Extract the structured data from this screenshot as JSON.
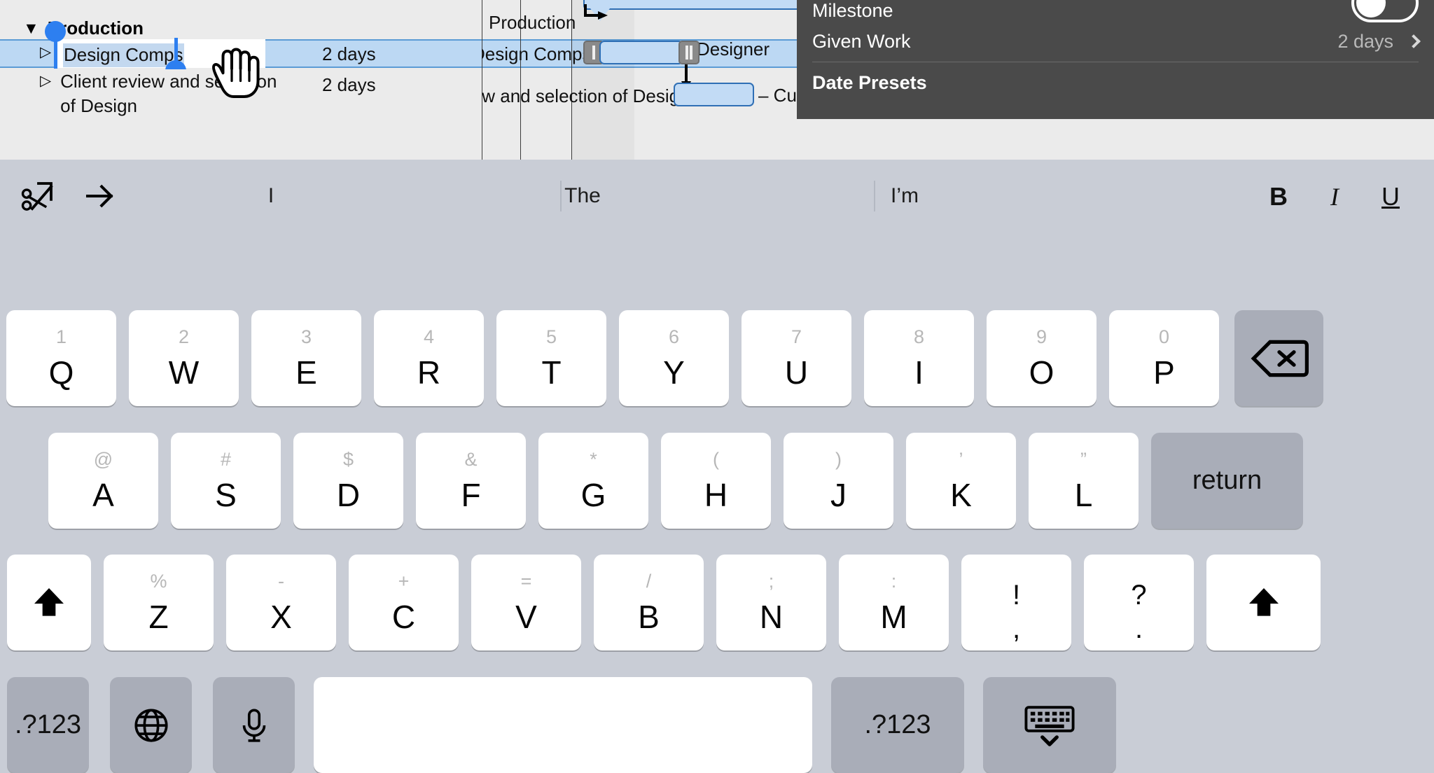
{
  "outline": {
    "group": {
      "triangle": "▼",
      "label": "Production"
    },
    "tasks": [
      {
        "triangle": "▷",
        "name": "Design Comps",
        "duration": "2 days",
        "editing": true
      },
      {
        "triangle": "▷",
        "name": "Client review and selection of Design",
        "duration": "2 days",
        "editing": false
      }
    ]
  },
  "gantt": {
    "labels": {
      "production": "Production",
      "design_comps": "Design Comps",
      "client_review": "iew and selection of Design",
      "designer": "Designer",
      "customer": "– Custo"
    }
  },
  "popover": {
    "milestone_label": "Milestone",
    "milestone_toggle": "off",
    "given_work": {
      "label": "Given Work",
      "value": "2 days",
      "chevron": "chevron-right"
    },
    "date_presets_label": "Date Presets"
  },
  "keyboard": {
    "toolbar": {
      "cut_icon": "scissors-icon",
      "indent_icon": "arrow-right-icon",
      "bold": "B",
      "italic": "I",
      "underline": "U"
    },
    "predictions": [
      "I",
      "The",
      "I’m"
    ],
    "rows": [
      [
        {
          "main": "Q",
          "alt": "1"
        },
        {
          "main": "W",
          "alt": "2"
        },
        {
          "main": "E",
          "alt": "3"
        },
        {
          "main": "R",
          "alt": "4"
        },
        {
          "main": "T",
          "alt": "5"
        },
        {
          "main": "Y",
          "alt": "6"
        },
        {
          "main": "U",
          "alt": "7"
        },
        {
          "main": "I",
          "alt": "8"
        },
        {
          "main": "O",
          "alt": "9"
        },
        {
          "main": "P",
          "alt": "0"
        }
      ],
      [
        {
          "main": "A",
          "alt": "@"
        },
        {
          "main": "S",
          "alt": "#"
        },
        {
          "main": "D",
          "alt": "$"
        },
        {
          "main": "F",
          "alt": "&"
        },
        {
          "main": "G",
          "alt": "*"
        },
        {
          "main": "H",
          "alt": "("
        },
        {
          "main": "J",
          "alt": ")"
        },
        {
          "main": "K",
          "alt": "’"
        },
        {
          "main": "L",
          "alt": "”"
        }
      ],
      [
        {
          "main": "Z",
          "alt": "%"
        },
        {
          "main": "X",
          "alt": "-"
        },
        {
          "main": "C",
          "alt": "+"
        },
        {
          "main": "V",
          "alt": "="
        },
        {
          "main": "B",
          "alt": "/"
        },
        {
          "main": "N",
          "alt": ";"
        },
        {
          "main": "M",
          "alt": ":"
        }
      ]
    ],
    "punctuation": [
      {
        "main": "!",
        "sub": ","
      },
      {
        "main": "?",
        "sub": "."
      }
    ],
    "special": {
      "backspace": "backspace-icon",
      "return": "return",
      "shift_left": "shift-icon",
      "shift_right": "shift-icon",
      "numbers_left": ".?123",
      "globe": "globe-icon",
      "microphone": "microphone-icon",
      "space": "",
      "numbers_right": ".?123",
      "hide_keyboard": "hide-keyboard-icon"
    }
  },
  "colors": {
    "selection_blue": "#bcd8f3",
    "accent_blue": "#2d7ff0",
    "bar_fill": "#c2dbf5",
    "bar_stroke": "#2f6fb5",
    "popover_bg": "#4a4a4a",
    "keyboard_bg": "#c9cdd6"
  }
}
